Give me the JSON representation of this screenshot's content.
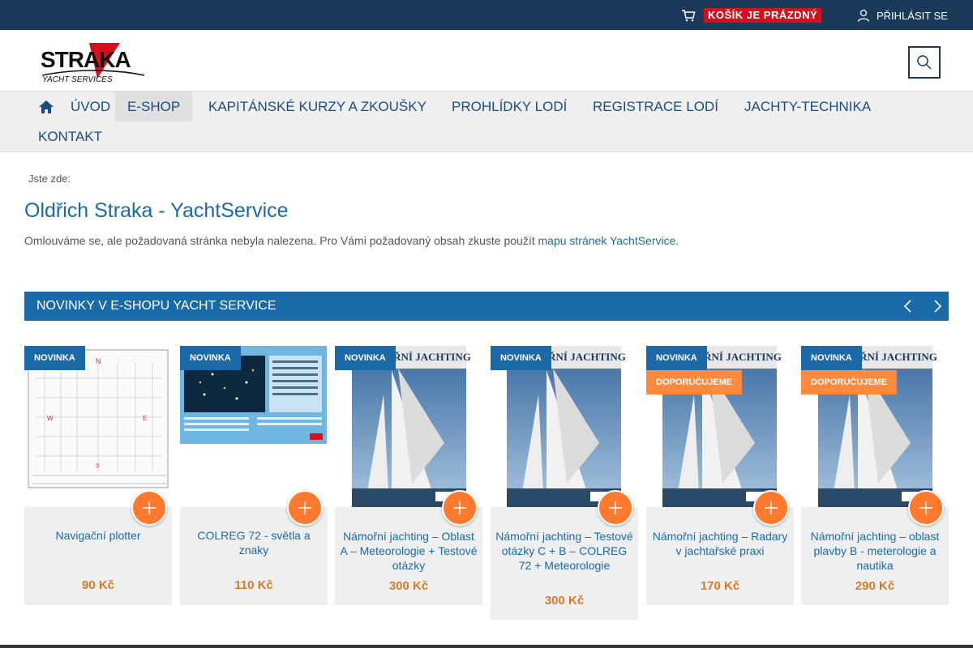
{
  "topbar": {
    "cart_label": "KOŠÍK JE PRÁZDNÝ",
    "login_label": "PŘIHLÁSIT SE"
  },
  "logo": {
    "text_main": "STRAKA",
    "text_sub": "YACHT SERVICES"
  },
  "nav": {
    "items": [
      {
        "label": "ÚVOD"
      },
      {
        "label": "E-SHOP"
      },
      {
        "label": "KAPITÁNSKÉ KURZY A ZKOUŠKY"
      },
      {
        "label": "PROHLÍDKY LODÍ"
      },
      {
        "label": "REGISTRACE LODÍ"
      },
      {
        "label": "JACHTY-TECHNIKA"
      },
      {
        "label": "KONTAKT"
      }
    ]
  },
  "breadcrumb": "Jste zde:",
  "page_title": "Oldřich Straka - YachtService",
  "message": {
    "text": "Omlouváme se, ale požadovaná stránka nebyla nalezena. Pro Vámi požadovaný obsah zkuste použít ",
    "link": "mapu stránek YachtService",
    "end": "."
  },
  "section": {
    "title": "NOVINKY V E-SHOPU YACHT SERVICE"
  },
  "badges": {
    "new": "NOVINKA",
    "recommended": "DOPORUČUJEME"
  },
  "products": [
    {
      "name": "Navigační plotter",
      "price": "90 Kč"
    },
    {
      "name": "COLREG 72 - světla a znaky",
      "price": "110 Kč"
    },
    {
      "name": "Námořní jachting – Oblast A – Meteorologie + Testové otázky",
      "price": "300 Kč"
    },
    {
      "name": "Námořní jachting – Testové otázky C + B – COLREG 72 + Meteorologie",
      "price": "300 Kč"
    },
    {
      "name": "Námořní jachting – Radary v jachtařské praxi",
      "price": "170 Kč"
    },
    {
      "name": "Námořní jachting – oblast plavby B - meterologie a nautika",
      "price": "290 Kč"
    }
  ],
  "book_cover_title": "NÁMOŘNÍ JACHTING",
  "colors": {
    "navy": "#1b3a5a",
    "blue": "#1b6aa8",
    "orange": "#ff7a2f",
    "red": "#d8101c"
  }
}
